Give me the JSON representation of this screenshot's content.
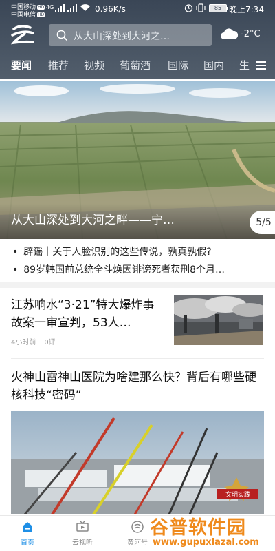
{
  "status_bar": {
    "carrier_1": "中国移动",
    "carrier_2": "中国电信",
    "hd_badge": "HD",
    "network": "4G",
    "speed": "0.96K/s",
    "battery": "85",
    "time": "晚上7:34"
  },
  "header": {
    "logo_icon": "app-logo-cloud",
    "search_placeholder": "从大山深处到大河之…",
    "weather_icon": "cloudy-icon",
    "temperature": "-2°C"
  },
  "tabs": [
    {
      "label": "要闻",
      "active": true
    },
    {
      "label": "推荐"
    },
    {
      "label": "视频"
    },
    {
      "label": "葡萄酒"
    },
    {
      "label": "国际"
    },
    {
      "label": "国内"
    },
    {
      "label": "生"
    }
  ],
  "hero": {
    "title": "从大山深处到大河之畔——宁…",
    "counter": "5/5"
  },
  "bullets": [
    "辟谣｜关于人脸识别的这些传说，孰真孰假?",
    "89岁韩国前总统全斗焕因诽谤死者获刑8个月…"
  ],
  "news_1": {
    "title": "江苏响水“3·21”特大爆炸事故案一审宣判，53人…",
    "time": "4小时前",
    "comments": "0评"
  },
  "news_2": {
    "title": "火神山雷神山医院为啥建那么快？背后有哪些硬核科技“密码”",
    "stamp_text": "文明实践"
  },
  "bottom_nav": [
    {
      "label": "首页",
      "icon": "home-icon",
      "active": true
    },
    {
      "label": "云视听",
      "icon": "tv-icon"
    },
    {
      "label": "黄河号",
      "icon": "yellow-river-icon"
    }
  ],
  "watermark": {
    "text": "谷普软件园",
    "url": "www.gupuxlazal.com"
  },
  "colors": {
    "header_bg": "#3a4656",
    "accent": "#1e8fe6",
    "watermark": "#ef8a1c"
  }
}
